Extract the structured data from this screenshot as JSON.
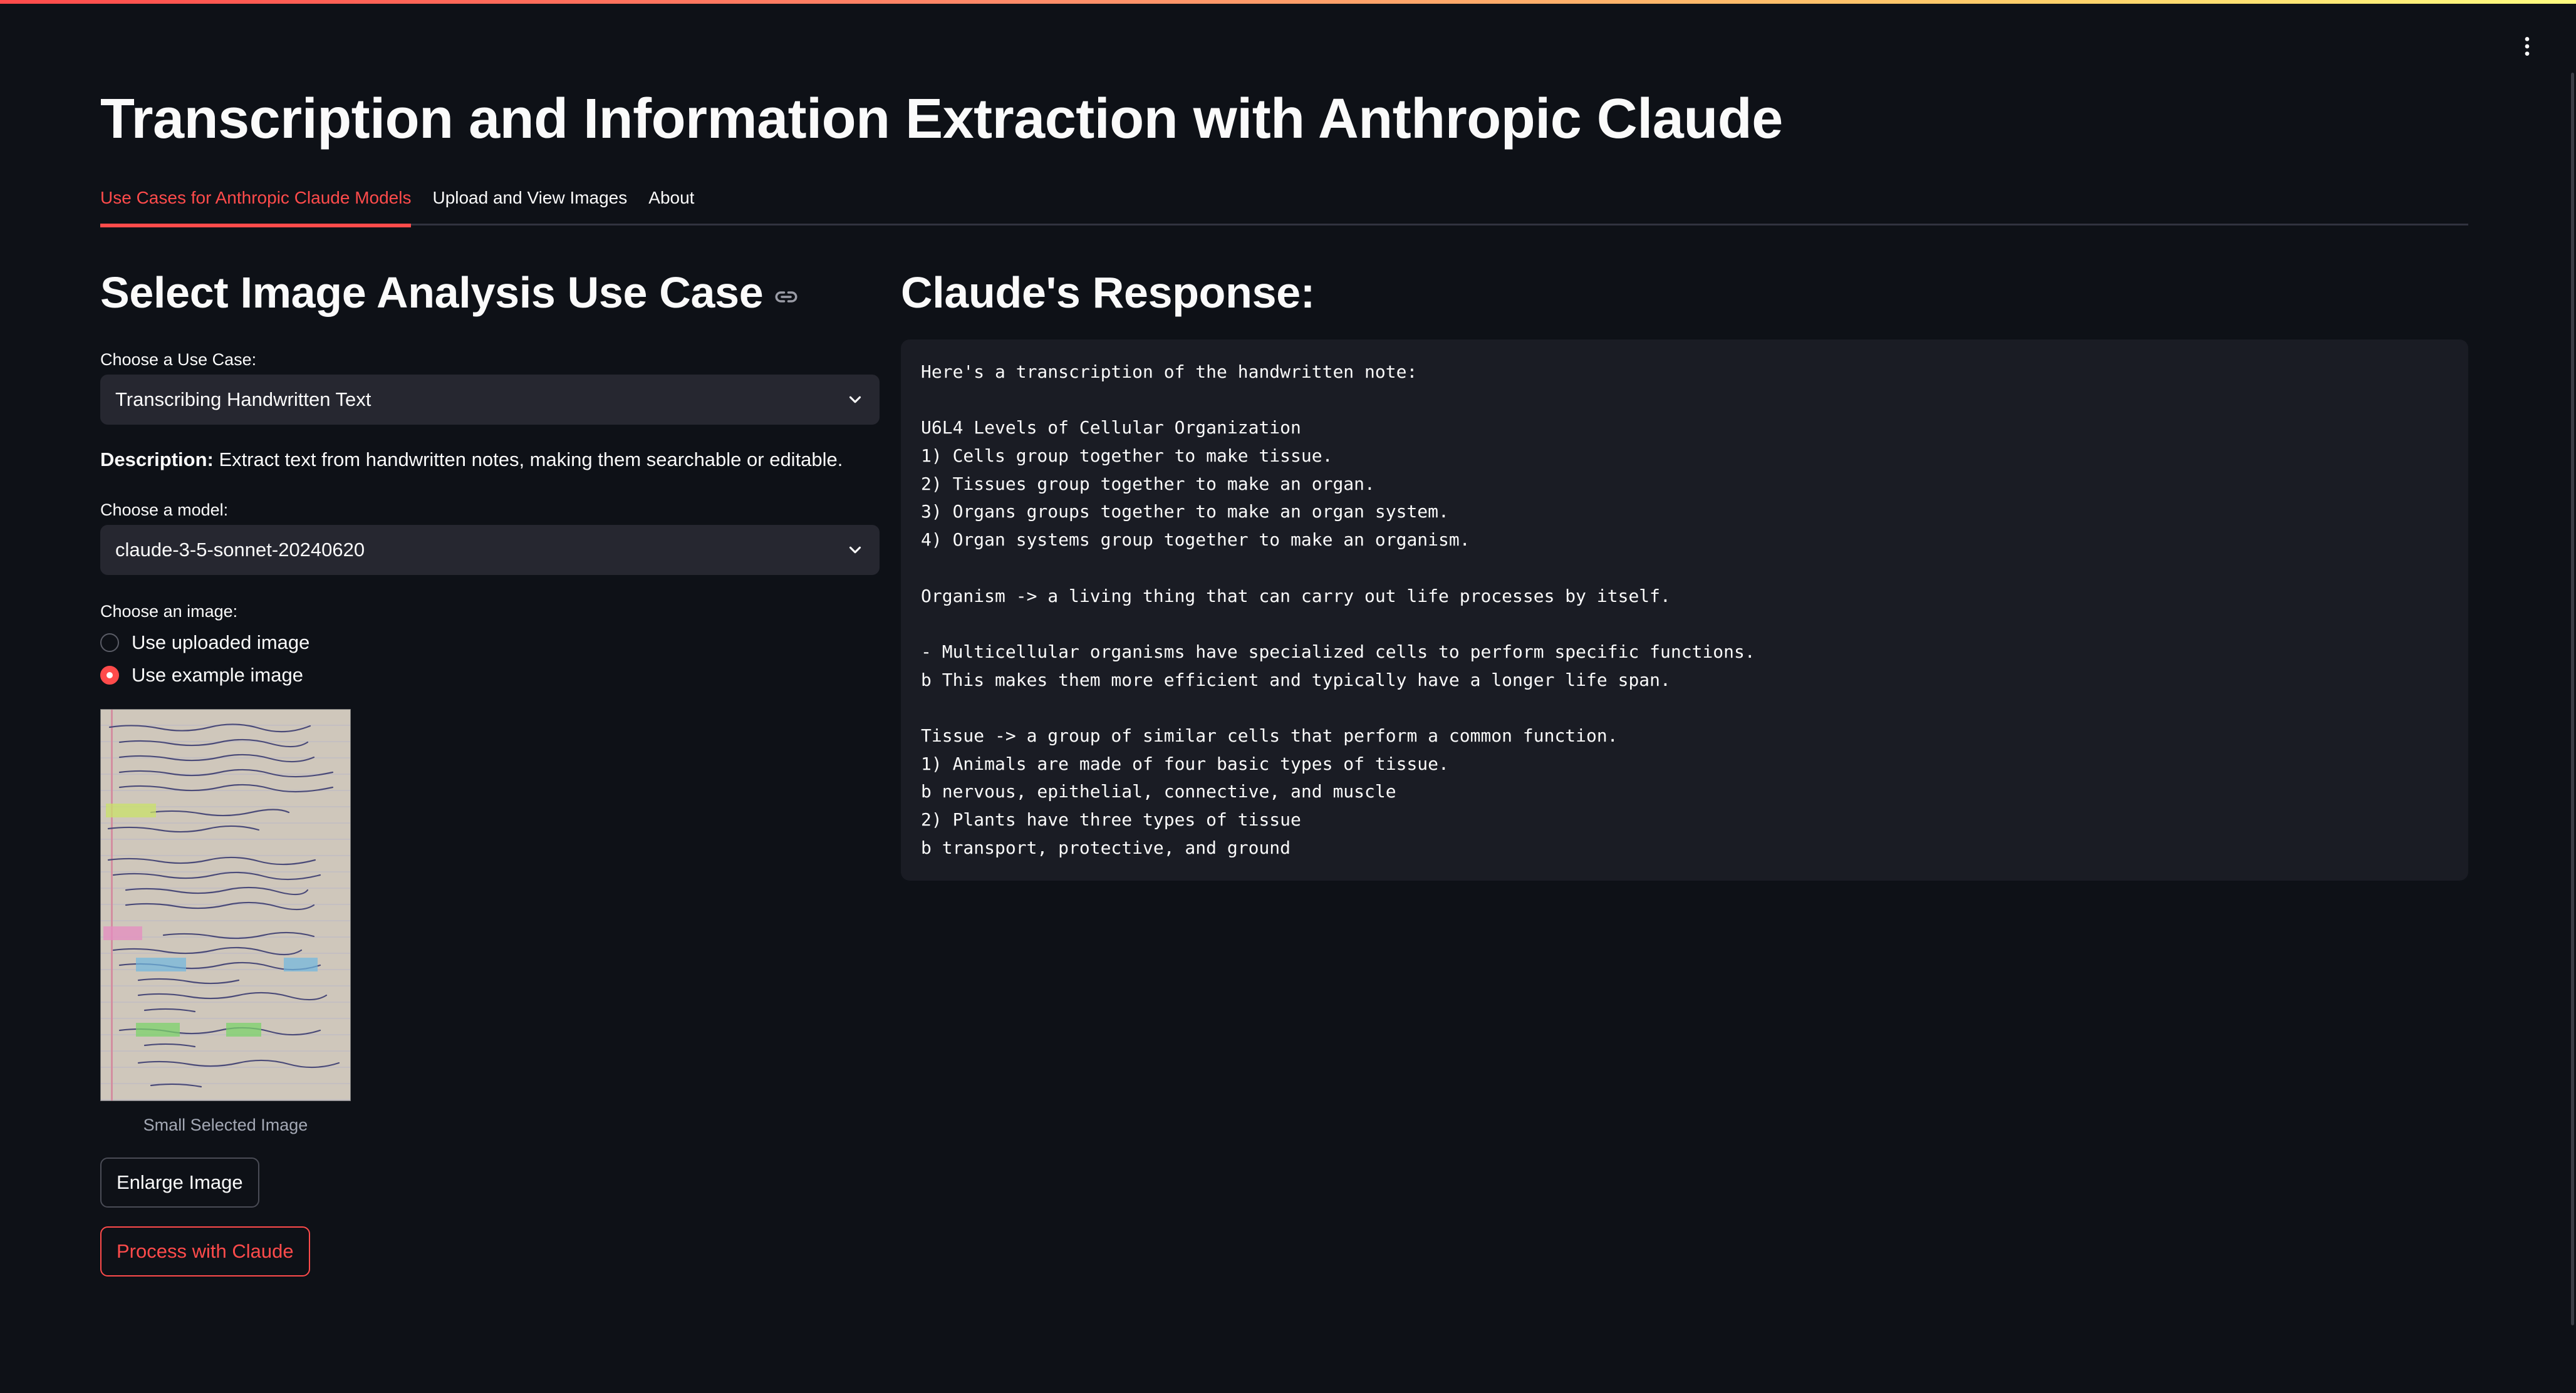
{
  "app": {
    "title": "Transcription and Information Extraction with Anthropic Claude",
    "tabs": [
      {
        "label": "Use Cases for Anthropic Claude Models",
        "active": true
      },
      {
        "label": "Upload and View Images",
        "active": false
      },
      {
        "label": "About",
        "active": false
      }
    ],
    "accent_color": "#ff4b4b",
    "background_color": "#0e1117"
  },
  "left": {
    "heading": "Select Image Analysis Use Case",
    "use_case_label": "Choose a Use Case:",
    "use_case_value": "Transcribing Handwritten Text",
    "description_label": "Description:",
    "description_text": " Extract text from handwritten notes, making them searchable or editable.",
    "model_label": "Choose a model:",
    "model_value": "claude-3-5-sonnet-20240620",
    "image_label": "Choose an image:",
    "image_options": [
      {
        "label": "Use uploaded image",
        "checked": false
      },
      {
        "label": "Use example image",
        "checked": true
      }
    ],
    "thumbnail_caption": "Small Selected Image",
    "enlarge_button": "Enlarge Image",
    "process_button": "Process with Claude"
  },
  "right": {
    "heading": "Claude's Response:",
    "response_lines": [
      "Here's a transcription of the handwritten note:",
      "",
      "U6L4 Levels of Cellular Organization",
      "1) Cells group together to make tissue.",
      "2) Tissues group together to make an organ.",
      "3) Organs groups together to make an organ system.",
      "4) Organ systems group together to make an organism.",
      "",
      "Organism -> a living thing that can carry out life processes by itself.",
      "",
      "- Multicellular organisms have specialized cells to perform specific functions.",
      "b This makes them more efficient and typically have a longer life span.",
      "",
      "Tissue -> a group of similar cells that perform a common function.",
      "1) Animals are made of four basic types of tissue.",
      "b nervous, epithelial, connective, and muscle",
      "2) Plants have three types of tissue",
      "b transport, protective, and ground"
    ]
  },
  "icons": {
    "menu": "kebab-menu-icon",
    "link": "link-icon",
    "dropdown": "chevron-down-icon"
  }
}
